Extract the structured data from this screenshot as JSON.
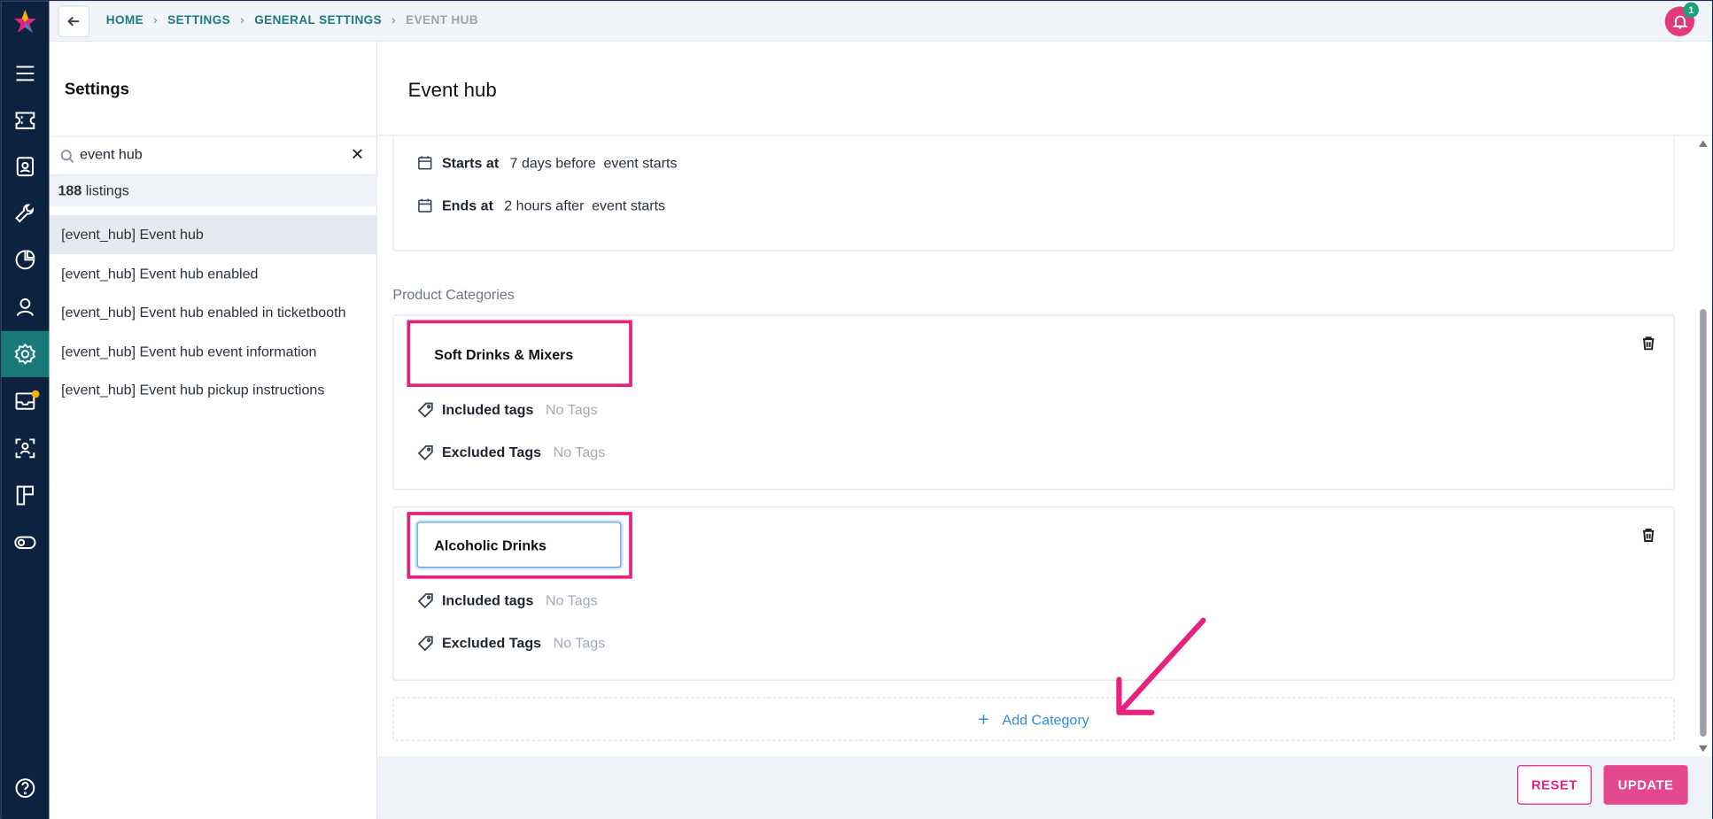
{
  "breadcrumb": {
    "items": [
      "HOME",
      "SETTINGS",
      "GENERAL SETTINGS"
    ],
    "current": "EVENT HUB"
  },
  "notifications": {
    "count": "1"
  },
  "sidebar": {
    "icons": [
      "menu-icon",
      "ticket-icon",
      "contact-card-icon",
      "wrench-icon",
      "pie-chart-icon",
      "user-icon",
      "gear-icon",
      "inbox-icon",
      "scan-user-icon",
      "layout-icon",
      "toggle-icon",
      "help-icon"
    ],
    "active": "gear-icon"
  },
  "settings": {
    "title": "Settings",
    "search_value": "event hub",
    "result_count": "188",
    "result_count_suffix": "listings",
    "results": [
      "[event_hub] Event hub",
      "[event_hub] Event hub enabled",
      "[event_hub] Event hub enabled in ticketbooth",
      "[event_hub] Event hub event information",
      "[event_hub] Event hub pickup instructions"
    ]
  },
  "main": {
    "title": "Event hub",
    "schedule": {
      "starts_label": "Starts at",
      "starts_value": "7 days before",
      "starts_suffix": "event starts",
      "ends_label": "Ends at",
      "ends_value": "2 hours after",
      "ends_suffix": "event starts"
    },
    "section_label": "Product Categories",
    "categories": [
      {
        "name": "Soft Drinks & Mixers",
        "included_label": "Included tags",
        "included_value": "No Tags",
        "excluded_label": "Excluded Tags",
        "excluded_value": "No Tags"
      },
      {
        "name": "Alcoholic Drinks",
        "included_label": "Included tags",
        "included_value": "No Tags",
        "excluded_label": "Excluded Tags",
        "excluded_value": "No Tags"
      }
    ],
    "add_category_label": "Add Category"
  },
  "footer": {
    "reset_label": "RESET",
    "update_label": "UPDATE"
  },
  "colors": {
    "accent": "#e4237f",
    "teal": "#1b7c7c",
    "rail": "#0d2240",
    "link": "#2b8fd6"
  }
}
